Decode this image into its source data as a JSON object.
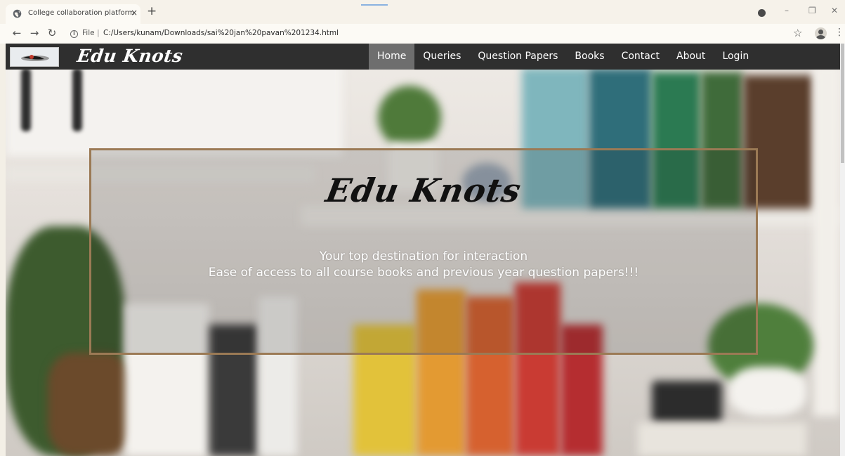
{
  "browser": {
    "tab_title": "College collaboration platform",
    "tab_close": "×",
    "new_tab": "+",
    "url_scheme": "File",
    "url_sep": "|",
    "url_path": "C:/Users/kunam/Downloads/sai%20jan%20pavan%201234.html",
    "window_controls": [
      "–",
      "❐",
      "✕"
    ]
  },
  "site": {
    "brand": "Edu Knots",
    "nav": [
      {
        "label": "Home",
        "active": true
      },
      {
        "label": "Queries",
        "active": false
      },
      {
        "label": "Question Papers",
        "active": false
      },
      {
        "label": "Books",
        "active": false
      },
      {
        "label": "Contact",
        "active": false
      },
      {
        "label": "About",
        "active": false
      },
      {
        "label": "Login",
        "active": false
      }
    ]
  },
  "hero": {
    "title": "Edu Knots",
    "line1": "Your top destination for interaction",
    "line2": "Ease of access to all course books and previous year question papers!!!"
  },
  "colors": {
    "nav_bg": "#2f2f2f",
    "nav_active": "#6e6e6e",
    "frame_border": "#9b7a55"
  },
  "icons": [
    "globe-icon",
    "back-arrow-icon",
    "forward-arrow-icon",
    "reload-icon",
    "info-icon",
    "star-icon",
    "account-icon",
    "kebab-icon"
  ]
}
